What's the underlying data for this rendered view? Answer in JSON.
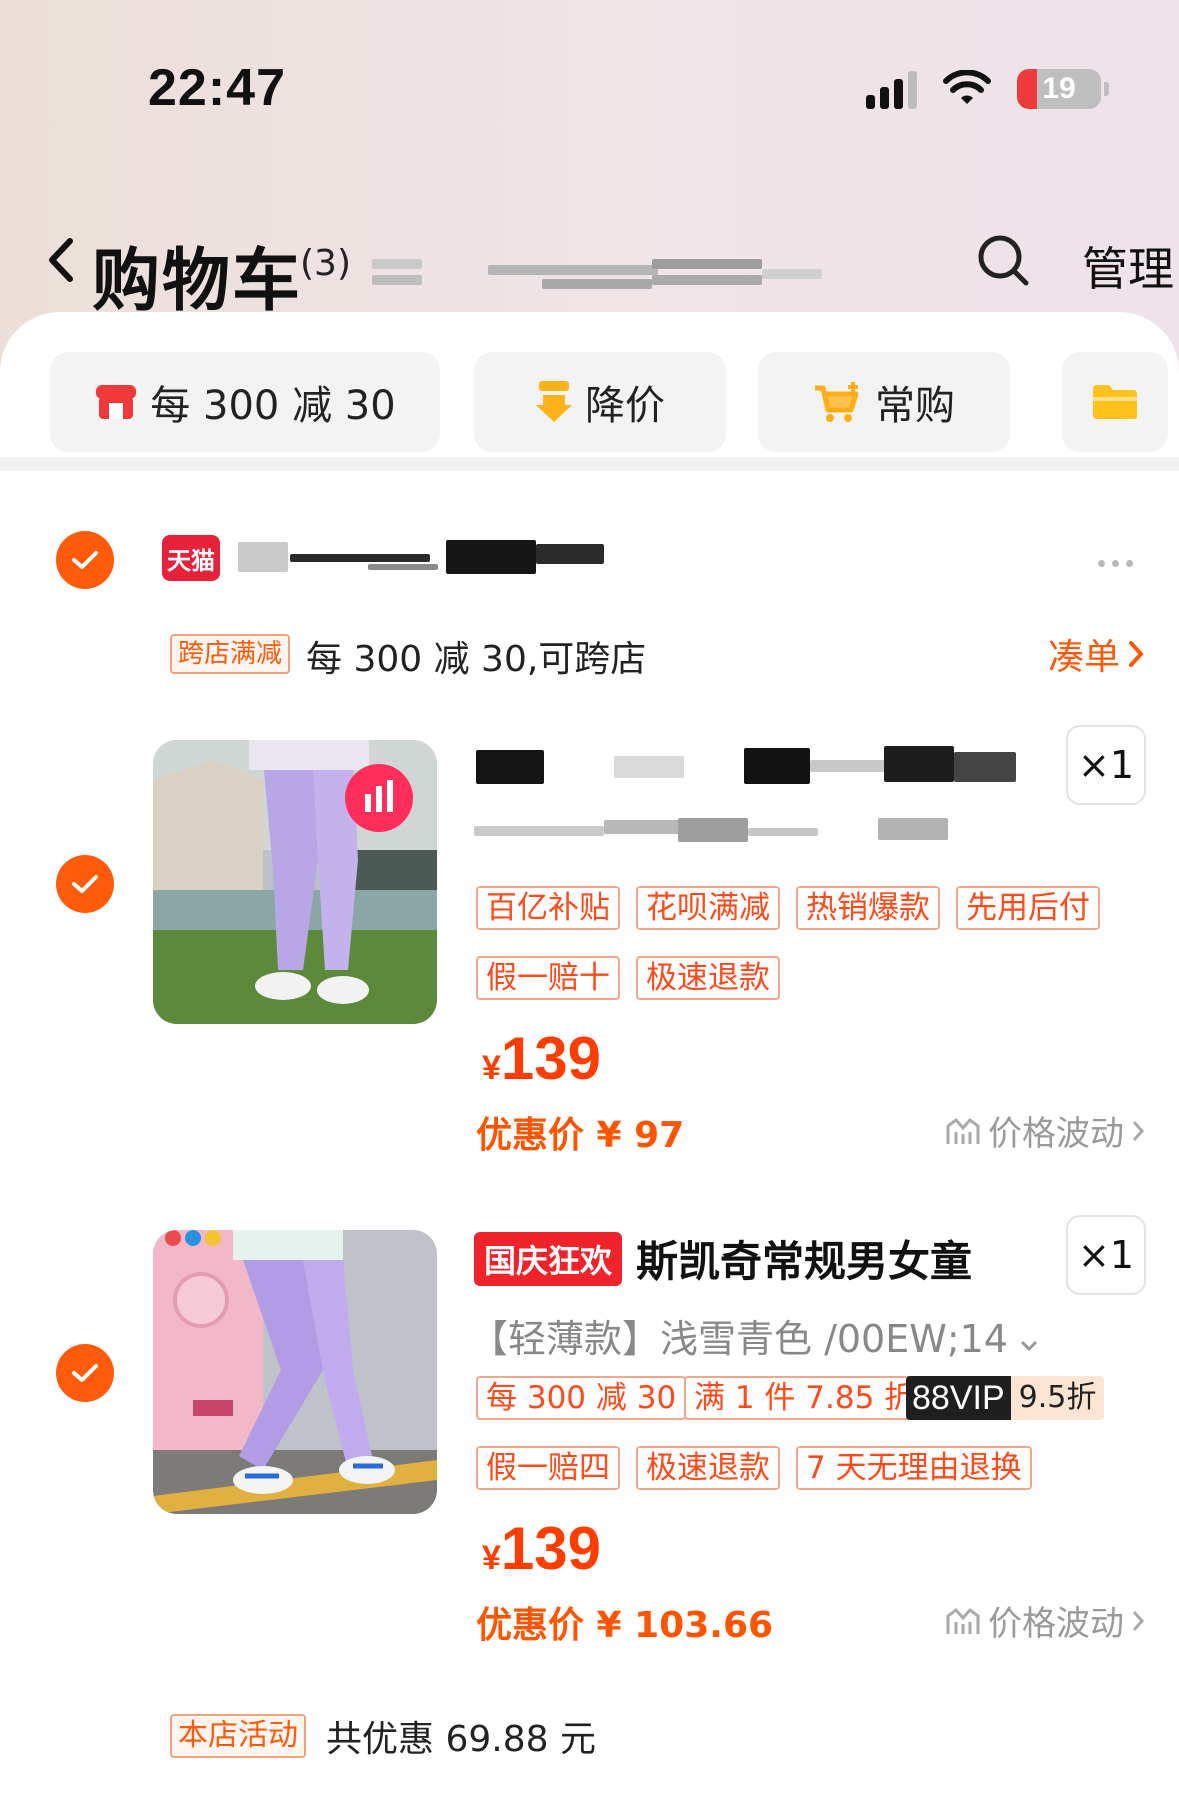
{
  "status_bar": {
    "time": "22:47",
    "battery": "19"
  },
  "nav": {
    "title": "购物车",
    "count": "(3)",
    "manage": "管理"
  },
  "filter_chips": [
    {
      "label": "每 300 减 30",
      "icon": "store-icon"
    },
    {
      "label": "降价",
      "icon": "price-drop-icon"
    },
    {
      "label": "常购",
      "icon": "cart-plus-icon"
    },
    {
      "label": "",
      "icon": "folder-icon"
    }
  ],
  "store": {
    "badge": "天猫",
    "promo_tag": "跨店满减",
    "promo_text": "每 300 减 30,可跨店",
    "coudan": "凑单"
  },
  "items": [
    {
      "title": "",
      "qty": "×1",
      "tags_row1": [
        "百亿补贴",
        "花呗满减",
        "热销爆款",
        "先用后付"
      ],
      "tags_row2": [
        "假一赔十",
        "极速退款"
      ],
      "price_symbol": "¥",
      "price": "139",
      "discount": "优惠价 ¥ 97",
      "trend": "价格波动"
    },
    {
      "badge": "国庆狂欢",
      "title": "斯凯奇常规男女童",
      "sku": "【轻薄款】浅雪青色 /00EW;14",
      "qty": "×1",
      "tags_row1": [
        "每 300 减 30",
        "满 1 件 7.85 折"
      ],
      "vip": {
        "label": "88VIP",
        "value": "9.5折"
      },
      "tags_row2": [
        "假一赔四",
        "极速退款",
        "7 天无理由退换"
      ],
      "price_symbol": "¥",
      "price": "139",
      "discount": "优惠价 ¥ 103.66",
      "trend": "价格波动"
    }
  ],
  "footer": {
    "tag": "本店活动",
    "text": "共优惠 69.88 元"
  },
  "colors": {
    "accent": "#ff5b0a",
    "price": "#ff3d00",
    "tmall": "#e8213b"
  }
}
